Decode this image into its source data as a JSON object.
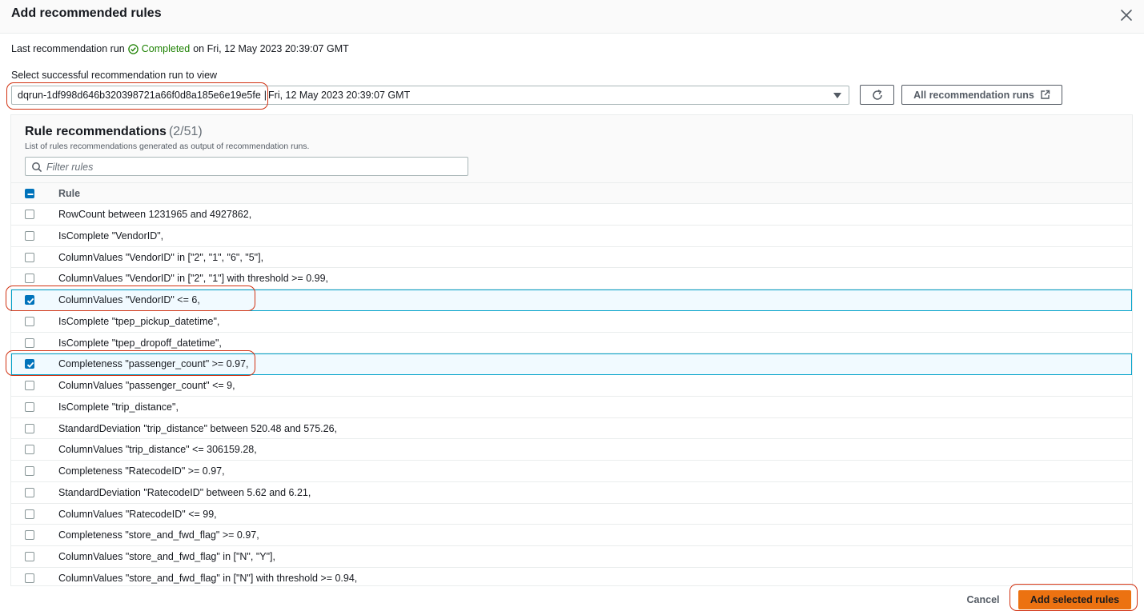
{
  "modal": {
    "title": "Add recommended rules",
    "close_icon": "close-icon"
  },
  "last_run": {
    "prefix": "Last recommendation run",
    "status": "Completed",
    "status_icon": "check-circle-icon",
    "status_color": "#1d8102",
    "suffix": "on Fri, 12 May 2023 20:39:07 GMT"
  },
  "run_select": {
    "label": "Select successful recommendation run to view",
    "run_id": "dqrun-1df998d646b320398721a66f0d8a185e6e19e5fe",
    "separator": "|",
    "run_date": "Fri, 12 May 2023 20:39:07 GMT",
    "caret_icon": "caret-down-icon"
  },
  "toolbar": {
    "refresh_icon": "refresh-icon",
    "all_runs_label": "All recommendation runs",
    "external_icon": "external-link-icon"
  },
  "rules_panel": {
    "title": "Rule recommendations",
    "count": "(2/51)",
    "description": "List of rules recommendations generated as output of recommendation runs.",
    "filter_placeholder": "Filter rules",
    "column_header": "Rule",
    "header_checkbox_state": "indeterminate",
    "rows": [
      {
        "rule": "RowCount between 1231965 and 4927862,",
        "checked": false
      },
      {
        "rule": "IsComplete \"VendorID\",",
        "checked": false
      },
      {
        "rule": "ColumnValues \"VendorID\" in [\"2\", \"1\", \"6\", \"5\"],",
        "checked": false
      },
      {
        "rule": "ColumnValues \"VendorID\" in [\"2\", \"1\"] with threshold >= 0.99,",
        "checked": false
      },
      {
        "rule": "ColumnValues \"VendorID\" <= 6,",
        "checked": true
      },
      {
        "rule": "IsComplete \"tpep_pickup_datetime\",",
        "checked": false
      },
      {
        "rule": "IsComplete \"tpep_dropoff_datetime\",",
        "checked": false
      },
      {
        "rule": "Completeness \"passenger_count\" >= 0.97,",
        "checked": true
      },
      {
        "rule": "ColumnValues \"passenger_count\" <= 9,",
        "checked": false
      },
      {
        "rule": "IsComplete \"trip_distance\",",
        "checked": false
      },
      {
        "rule": "StandardDeviation \"trip_distance\" between 520.48 and 575.26,",
        "checked": false
      },
      {
        "rule": "ColumnValues \"trip_distance\" <= 306159.28,",
        "checked": false
      },
      {
        "rule": "Completeness \"RatecodeID\" >= 0.97,",
        "checked": false
      },
      {
        "rule": "StandardDeviation \"RatecodeID\" between 5.62 and 6.21,",
        "checked": false
      },
      {
        "rule": "ColumnValues \"RatecodeID\" <= 99,",
        "checked": false
      },
      {
        "rule": "Completeness \"store_and_fwd_flag\" >= 0.97,",
        "checked": false
      },
      {
        "rule": "ColumnValues \"store_and_fwd_flag\" in [\"N\", \"Y\"],",
        "checked": false
      },
      {
        "rule": "ColumnValues \"store_and_fwd_flag\" in [\"N\"] with threshold >= 0.94,",
        "checked": false
      }
    ]
  },
  "footer": {
    "cancel_label": "Cancel",
    "add_label": "Add selected rules",
    "primary_color": "#ec7211"
  }
}
